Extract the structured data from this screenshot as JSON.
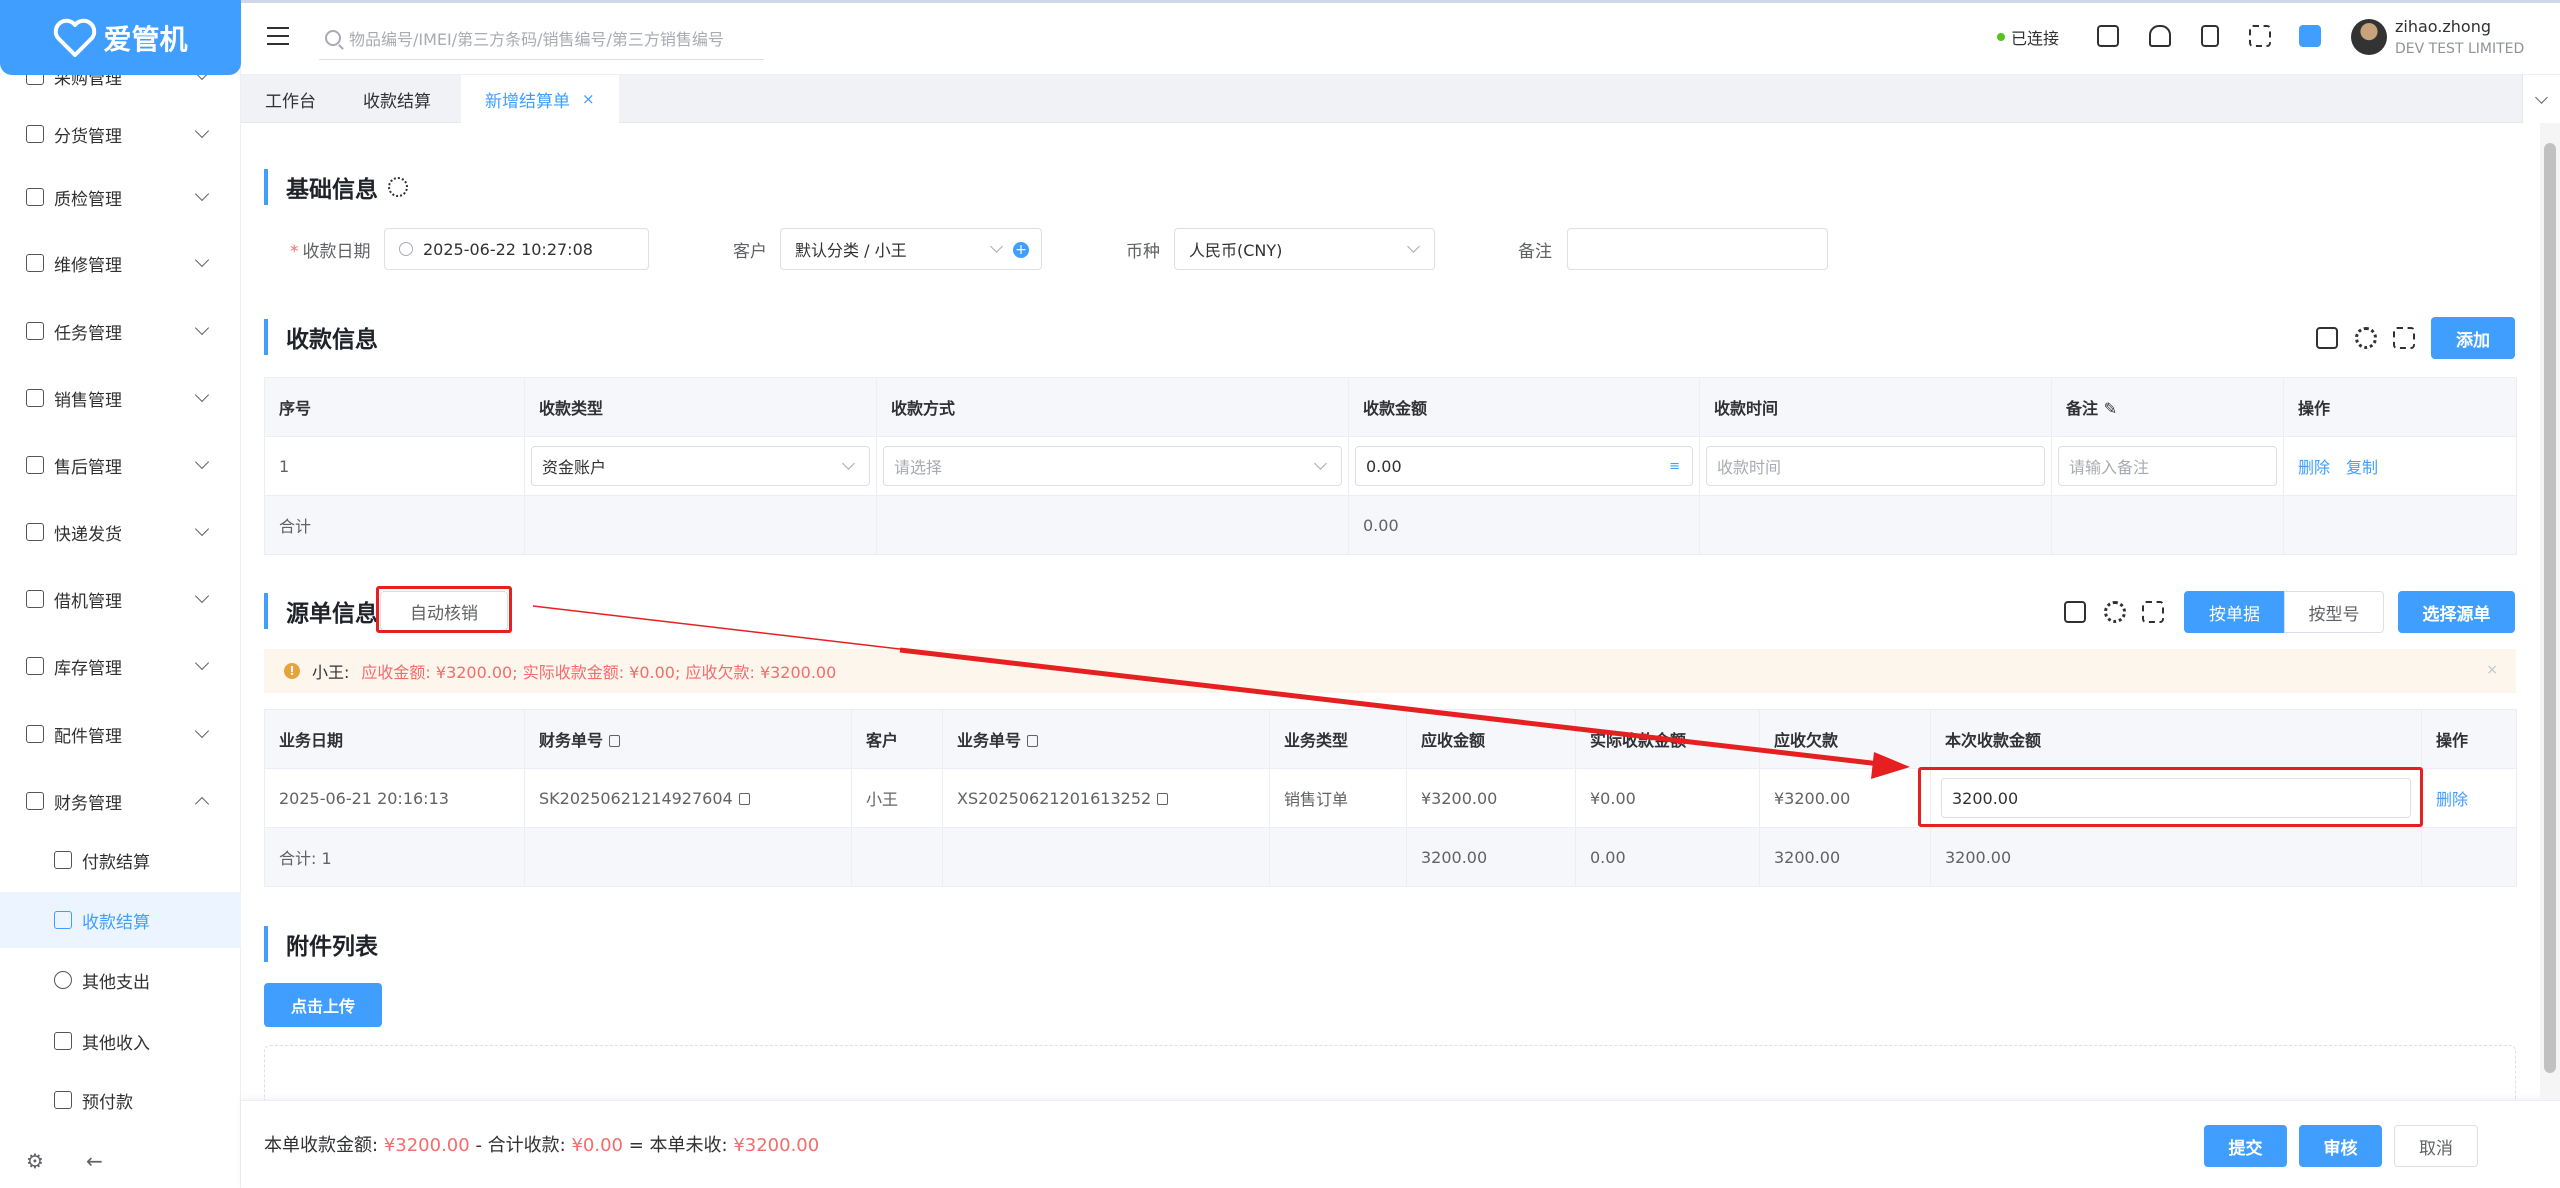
{
  "app": {
    "logo": "爱管机"
  },
  "header": {
    "search_placeholder": "物品编号/IMEI/第三方条码/销售编号/第三方销售编号",
    "status": "已连接",
    "user_name": "zihao.zhong",
    "company": "DEV TEST LIMITED"
  },
  "sidebar": {
    "items": [
      {
        "label": "采购管理"
      },
      {
        "label": "分货管理"
      },
      {
        "label": "质检管理"
      },
      {
        "label": "维修管理"
      },
      {
        "label": "任务管理"
      },
      {
        "label": "销售管理"
      },
      {
        "label": "售后管理"
      },
      {
        "label": "快递发货"
      },
      {
        "label": "借机管理"
      },
      {
        "label": "库存管理"
      },
      {
        "label": "配件管理"
      },
      {
        "label": "财务管理"
      }
    ],
    "subitems": [
      {
        "label": "付款结算"
      },
      {
        "label": "收款结算"
      },
      {
        "label": "其他支出"
      },
      {
        "label": "其他收入"
      },
      {
        "label": "预付款"
      }
    ]
  },
  "tabs": [
    {
      "label": "工作台"
    },
    {
      "label": "收款结算"
    },
    {
      "label": "新增结算单",
      "close": "×"
    }
  ],
  "basic": {
    "title": "基础信息",
    "req": "*",
    "date_label": "收款日期",
    "date_value": "2025-06-22 10:27:08",
    "customer_label": "客户",
    "customer_value": "默认分类 / 小王",
    "plus": "+",
    "currency_label": "币种",
    "currency_value": "人民币(CNY)",
    "remark_label": "备注"
  },
  "receipt": {
    "title": "收款信息",
    "add_btn": "添加",
    "headers": [
      "序号",
      "收款类型",
      "收款方式",
      "收款金额",
      "收款时间",
      "备注",
      "操作"
    ],
    "row": {
      "index": "1",
      "type": "资金账户",
      "method_ph": "请选择",
      "amount": "0.00",
      "time_ph": "收款时间",
      "remark_ph": "请输入备注",
      "delete": "删除",
      "copy": "复制"
    },
    "sum_label": "合计",
    "sum_amount": "0.00"
  },
  "source": {
    "title": "源单信息",
    "auto_btn": "自动核销",
    "by_doc": "按单据",
    "by_model": "按型号",
    "select_btn": "选择源单",
    "alert": {
      "name": "小王:",
      "text": "应收金额: ¥3200.00;  实际收款金额: ¥0.00;  应收欠款: ¥3200.00",
      "close": "×",
      "icon": "!"
    },
    "headers": [
      "业务日期",
      "财务单号",
      "客户",
      "业务单号",
      "业务类型",
      "应收金额",
      "实际收款金额",
      "应收欠款",
      "本次收款金额",
      "操作"
    ],
    "row": {
      "date": "2025-06-21 20:16:13",
      "fin_no": "SK20250621214927604",
      "customer": "小王",
      "biz_no": "XS20250621201613252",
      "biz_type": "销售订单",
      "receivable": "¥3200.00",
      "actual": "¥0.00",
      "owed": "¥3200.00",
      "this_amount": "3200.00",
      "delete": "删除"
    },
    "sum": {
      "label": "合计: 1",
      "receivable": "3200.00",
      "actual": "0.00",
      "owed": "3200.00",
      "this_amount": "3200.00"
    }
  },
  "attach": {
    "title": "附件列表",
    "upload_btn": "点击上传"
  },
  "footer": {
    "l1": "本单收款金额:",
    "v1": "¥3200.00",
    "l2": "- 合计收款:",
    "v2": "¥0.00",
    "l3": "= 本单未收:",
    "v3": "¥3200.00",
    "submit": "提交",
    "audit": "审核",
    "cancel": "取消"
  },
  "colors": {
    "primary": "#409eff",
    "danger": "#f56c6c",
    "annotation": "#e62020"
  }
}
